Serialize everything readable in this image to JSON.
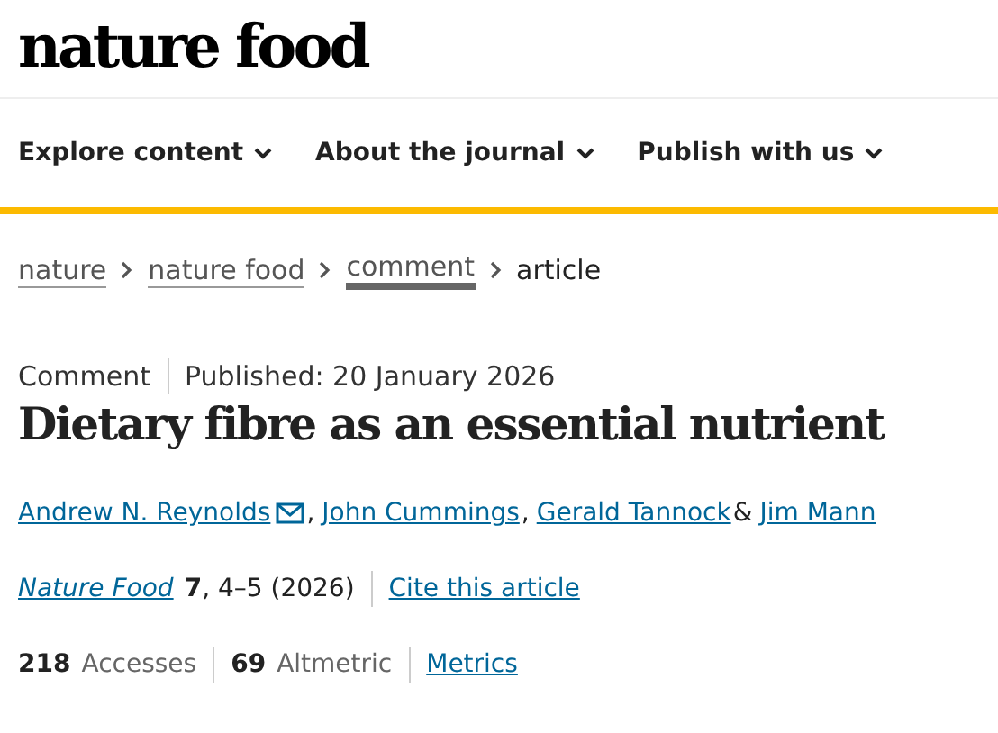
{
  "logo": "nature food",
  "nav": [
    {
      "label": "Explore content"
    },
    {
      "label": "About the journal"
    },
    {
      "label": "Publish with us"
    }
  ],
  "breadcrumb": [
    {
      "label": "nature",
      "link": true,
      "focused": false
    },
    {
      "label": "nature food",
      "link": true,
      "focused": false
    },
    {
      "label": "comment",
      "link": true,
      "focused": true
    },
    {
      "label": "article",
      "link": false,
      "focused": false
    }
  ],
  "article_type": "Comment",
  "published": "Published: 20 January 2026",
  "title": "Dietary fibre as an essential nutrient",
  "authors": [
    {
      "name": "Andrew N. Reynolds",
      "email": true,
      "separator": ","
    },
    {
      "name": "John Cummings",
      "email": false,
      "separator": ","
    },
    {
      "name": "Gerald Tannock",
      "email": false,
      "separator": "&"
    },
    {
      "name": "Jim Mann",
      "email": false
    }
  ],
  "citation": {
    "journal": "Nature Food",
    "details": "**7**, 4–5 (2026)",
    "cite_link": "Cite this article"
  },
  "metrics": [
    {
      "count": "218",
      "label": "Accesses"
    },
    {
      "count": "69",
      "label": "Altmetric"
    }
  ],
  "metrics_link": "Metrics"
}
